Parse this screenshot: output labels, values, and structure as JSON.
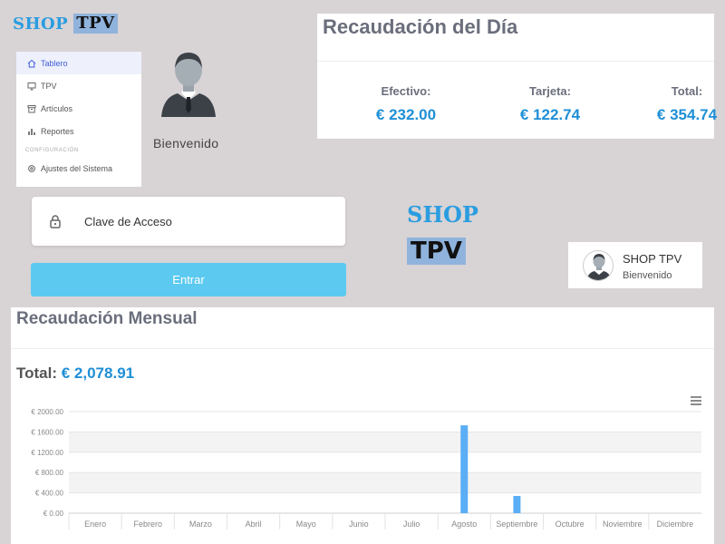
{
  "logo": {
    "shop": "SHOP",
    "tpv": "TPV"
  },
  "sidebar": {
    "items": [
      {
        "label": "Tablero",
        "icon": "home-icon",
        "active": true
      },
      {
        "label": "TPV",
        "icon": "monitor-icon",
        "active": false
      },
      {
        "label": "Artículos",
        "icon": "archive-icon",
        "active": false
      },
      {
        "label": "Reportes",
        "icon": "bar-chart-icon",
        "active": false
      }
    ],
    "section_label": "CONFIGURACIÓN",
    "settings_item": {
      "label": "Ajustes del Sistema",
      "icon": "gear-icon"
    }
  },
  "welcome": "Bienvenido",
  "daily": {
    "title": "Recaudación del Día",
    "cash_label": "Efectivo:",
    "cash_value": "€ 232.00",
    "card_label": "Tarjeta:",
    "card_value": "€ 122.74",
    "total_label": "Total:",
    "total_value": "€ 354.74"
  },
  "login": {
    "password_placeholder": "Clave de Acceso",
    "submit_label": "Entrar"
  },
  "user_card": {
    "name": "SHOP TPV",
    "subtitle": "Bienvenido"
  },
  "monthly": {
    "title": "Recaudación Mensual",
    "total_label": "Total:",
    "total_value": "€ 2,078.91"
  },
  "colors": {
    "accent": "#1f8fd6",
    "button": "#5ccaf0",
    "bar": "#5aaef5"
  },
  "chart_data": {
    "type": "bar",
    "categories": [
      "Enero",
      "Febrero",
      "Marzo",
      "Abril",
      "Mayo",
      "Junio",
      "Julio",
      "Agosto",
      "Septiembre",
      "Octubre",
      "Noviembre",
      "Diciembre"
    ],
    "values": [
      0,
      0,
      0,
      0,
      0,
      0,
      0,
      1730,
      340,
      0,
      0,
      0
    ],
    "yticks": [
      "€ 0.00",
      "€ 400.00",
      "€ 800.00",
      "€ 1200.00",
      "€ 1600.00",
      "€ 2000.00"
    ],
    "ylim": [
      0,
      2000
    ],
    "title": "",
    "xlabel": "",
    "ylabel": "",
    "grid": true
  }
}
